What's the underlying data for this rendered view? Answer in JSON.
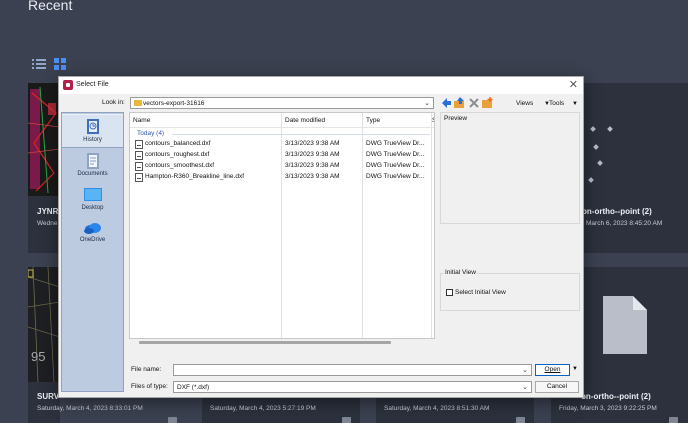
{
  "app": {
    "title": "Recent",
    "view_icons": [
      "list-view-icon",
      "grid-view-icon"
    ],
    "tiles": [
      {
        "name": "JYNR",
        "date": "Wedne"
      },
      {
        "name": "on-ortho--point (2)",
        "date": "March 6, 2023 8:45:20 AM"
      },
      {
        "name": "SURV",
        "date": "Saturday, March 4, 2023 8:33:01 PM"
      },
      {
        "name": "",
        "date": "Saturday, March 4, 2023 5:27:19 PM"
      },
      {
        "name": "",
        "date": "Saturday, March 4, 2023 8:51:30 AM"
      },
      {
        "name": "on-ortho--point (2)",
        "date": "Friday, March 3, 2023 9:22:25 PM"
      }
    ],
    "thumb_overlay_text": "95"
  },
  "dialog": {
    "title": "Select File",
    "look_in_label": "Look in:",
    "look_in_value": "vectors-export-31616",
    "toolbar": {
      "views_label": "Views",
      "tools_label": "Tools",
      "icons": [
        "back-icon",
        "up-folder-icon",
        "delete-icon",
        "new-folder-icon"
      ]
    },
    "places": [
      {
        "label": "History",
        "icon": "history-icon"
      },
      {
        "label": "Documents",
        "icon": "documents-icon"
      },
      {
        "label": "Desktop",
        "icon": "desktop-icon"
      },
      {
        "label": "OneDrive",
        "icon": "onedrive-icon"
      }
    ],
    "columns": {
      "name": "Name",
      "date": "Date modified",
      "type": "Type",
      "size": "S"
    },
    "group_header": "Today (4)",
    "files": [
      {
        "name": "contours_balanced.dxf",
        "date": "3/13/2023 9:38 AM",
        "type": "DWG TrueView Dr..."
      },
      {
        "name": "contours_roughest.dxf",
        "date": "3/13/2023 9:38 AM",
        "type": "DWG TrueView Dr..."
      },
      {
        "name": "contours_smoothest.dxf",
        "date": "3/13/2023 9:38 AM",
        "type": "DWG TrueView Dr..."
      },
      {
        "name": "Hampton-R360_Breakline_line.dxf",
        "date": "3/13/2023 9:38 AM",
        "type": "DWG TrueView Dr..."
      }
    ],
    "preview_label": "Preview",
    "initial_view_label": "Initial View",
    "select_initial_view_label": "Select Initial View",
    "file_name_label": "File name:",
    "file_name_value": "",
    "files_of_type_label": "Files of type:",
    "files_of_type_value": "DXF (*.dxf)",
    "open_button_label": "Open",
    "cancel_button_label": "Cancel"
  }
}
